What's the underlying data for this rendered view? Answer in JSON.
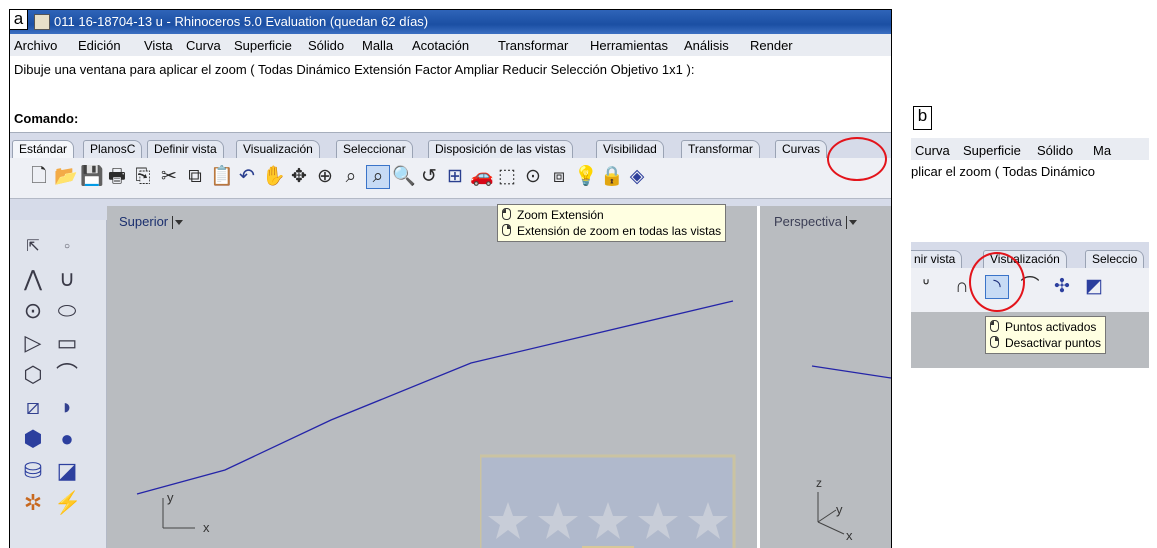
{
  "labels": {
    "a": "a",
    "b": "b"
  },
  "titlebar": {
    "title": "011 16-18704-13 u - Rhinoceros 5.0 Evaluation (quedan 62 días)"
  },
  "menubar": [
    "Archivo",
    "Edición",
    "Vista",
    "Curva",
    "Superficie",
    "Sólido",
    "Malla",
    "Acotación",
    "Transformar",
    "Herramientas",
    "Análisis",
    "Render"
  ],
  "prompt": {
    "message": "Dibuje una ventana para aplicar el zoom ( Todas  Dinámico  Extensión  Factor  Ampliar  Reducir  Selección  Objetivo  1x1 ):"
  },
  "command": {
    "label": "Comando:",
    "value": ""
  },
  "tabs": [
    "Estándar",
    "PlanosC",
    "Definir vista",
    "Visualización",
    "Seleccionar",
    "Disposición de las vistas",
    "Visibilidad",
    "Transformar",
    "Curvas"
  ],
  "viewports": {
    "top": "Superior",
    "perspective": "Perspectiva"
  },
  "tooltip_a": {
    "left": "Zoom Extensión",
    "right": "Extensión de zoom en todas las vistas"
  },
  "axes": {
    "x": "x",
    "y": "y",
    "z": "z"
  },
  "panel_b": {
    "menubar": [
      "Curva",
      "Superficie",
      "Sólido",
      "Ma"
    ],
    "prompt": "plicar el zoom ( Todas  Dinámico",
    "tabs": [
      "nir vista",
      "Visualización",
      "Seleccio"
    ],
    "tooltip": {
      "left": "Puntos activados",
      "right": "Desactivar puntos"
    }
  },
  "colors": {
    "titlebar": "#1b4fa3",
    "viewport": "#b9bcc0",
    "curve": "#2424a8",
    "highlight": "#e3141b"
  }
}
